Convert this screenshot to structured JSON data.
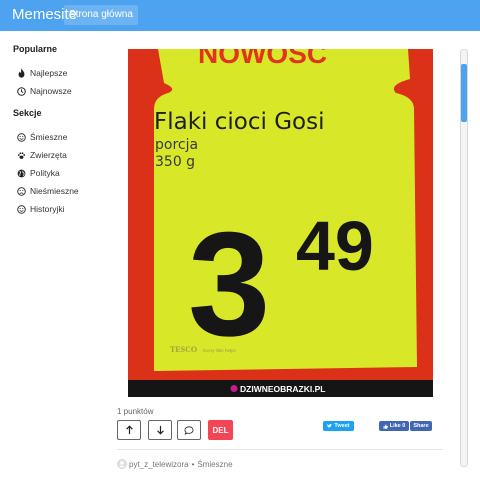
{
  "header": {
    "brand": "Memesite",
    "home_link": "Strona główna"
  },
  "sidebar": {
    "popular_title": "Popularne",
    "popular": [
      {
        "label": "Najlepsze",
        "icon": "fire-icon"
      },
      {
        "label": "Najnowsze",
        "icon": "clock-icon"
      }
    ],
    "sections_title": "Sekcje",
    "sections": [
      {
        "label": "Śmieszne",
        "icon": "smile-icon"
      },
      {
        "label": "Zwierzęta",
        "icon": "paw-icon"
      },
      {
        "label": "Polityka",
        "icon": "globe-icon"
      },
      {
        "label": "Nieśmieszne",
        "icon": "frown-icon"
      },
      {
        "label": "Historyjki",
        "icon": "smile-icon"
      }
    ]
  },
  "post": {
    "image": {
      "banner": "NOWOŚĆ",
      "title": "Flaki cioci Gosi",
      "portion_label": "porcja",
      "portion_size": "350 g",
      "price_main": "3",
      "price_cents": "49",
      "store_logo": "TESCO",
      "store_tagline": "Every little helps",
      "watermark": "DZIWNEOBRAZKI.PL"
    },
    "points": "1 punktów",
    "actions": {
      "delete_label": "DEL"
    },
    "share": {
      "tweet_label": "Tweet",
      "like_label": "Like 0",
      "share_label": "Share"
    },
    "author": "pyt_z_telewizora",
    "separator": "•",
    "category": "Śmieszne"
  },
  "colors": {
    "accent": "#4da3ef",
    "delete": "#f44556",
    "tag": "#d8e829",
    "tag_bg": "#e1351b"
  }
}
